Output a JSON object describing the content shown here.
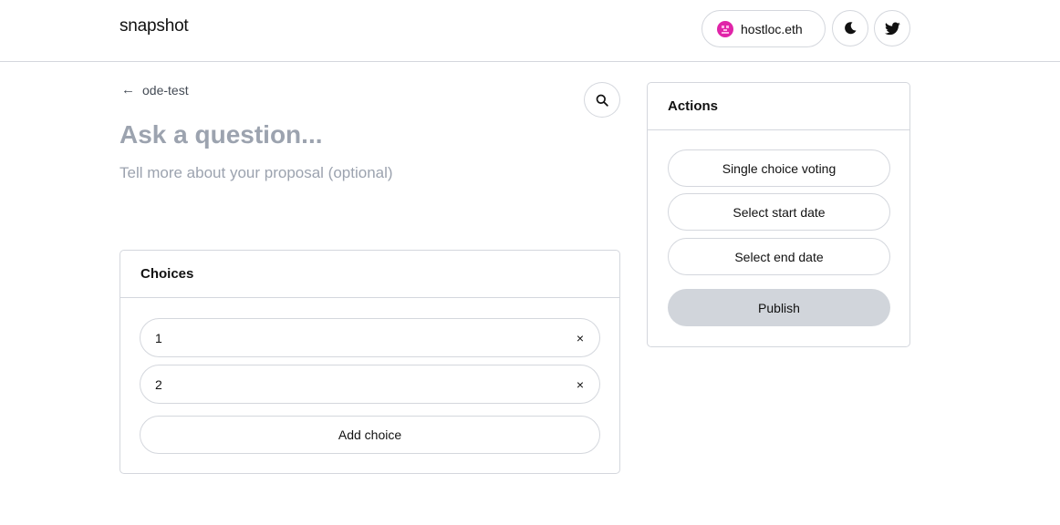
{
  "header": {
    "brand": "snapshot",
    "account_label": "hostloc.eth",
    "avatar_color": "#e024a8"
  },
  "nav": {
    "back_label": "ode-test"
  },
  "proposal": {
    "title_placeholder": "Ask a question...",
    "body_placeholder": "Tell more about your proposal (optional)"
  },
  "choices": {
    "heading": "Choices",
    "items": [
      {
        "value": "1",
        "remove_icon": "×"
      },
      {
        "value": "2",
        "remove_icon": "×"
      }
    ],
    "add_label": "Add choice"
  },
  "actions": {
    "heading": "Actions",
    "voting_type_label": "Single choice voting",
    "start_date_label": "Select start date",
    "end_date_label": "Select end date",
    "publish_label": "Publish"
  },
  "icons": {
    "back": "arrow-left-icon",
    "search": "search-icon",
    "theme": "moon-icon",
    "social": "twitter-icon",
    "remove": "close-icon"
  }
}
